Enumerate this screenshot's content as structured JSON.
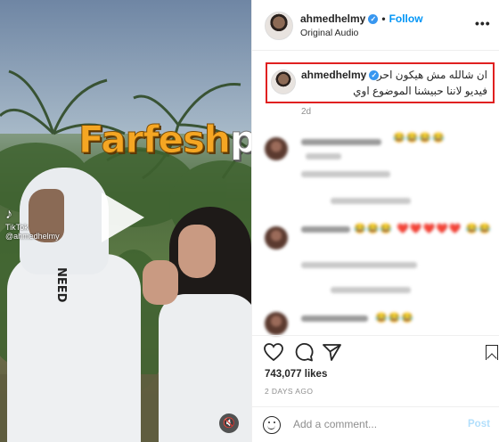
{
  "video": {
    "watermark_part1": "Farfesh",
    "watermark_part2": "plus.com",
    "tiktok_label": "TikTok",
    "tiktok_handle": "@ahmedhelmy",
    "shirt_print": "NEED"
  },
  "header": {
    "username": "ahmedhelmy",
    "separator": "•",
    "follow_label": "Follow",
    "audio_label": "Original Audio",
    "more_icon": "more-icon"
  },
  "caption": {
    "username": "ahmedhelmy",
    "line1": "ان شالله مش هيكون احر",
    "line2": "فيديو لاننا حبيشنا الموضوع اوي",
    "age": "2d"
  },
  "comments": [
    {
      "emoji": "😂😂😂😂"
    },
    {
      "emoji": "😂😂😂 ❤️❤️❤️❤️❤️ 😂😂"
    },
    {
      "emoji": "😂😂😂"
    }
  ],
  "actions": {
    "like_icon": "heart-icon",
    "comment_icon": "comment-icon",
    "share_icon": "share-icon",
    "save_icon": "bookmark-icon"
  },
  "likes": "743,077 likes",
  "date": "2 DAYS AGO",
  "add_comment": {
    "placeholder": "Add a comment...",
    "post_label": "Post"
  },
  "colors": {
    "accent": "#0095f6",
    "verified": "#3897f0",
    "highlight_border": "#e02020",
    "watermark": "#f5a623"
  }
}
